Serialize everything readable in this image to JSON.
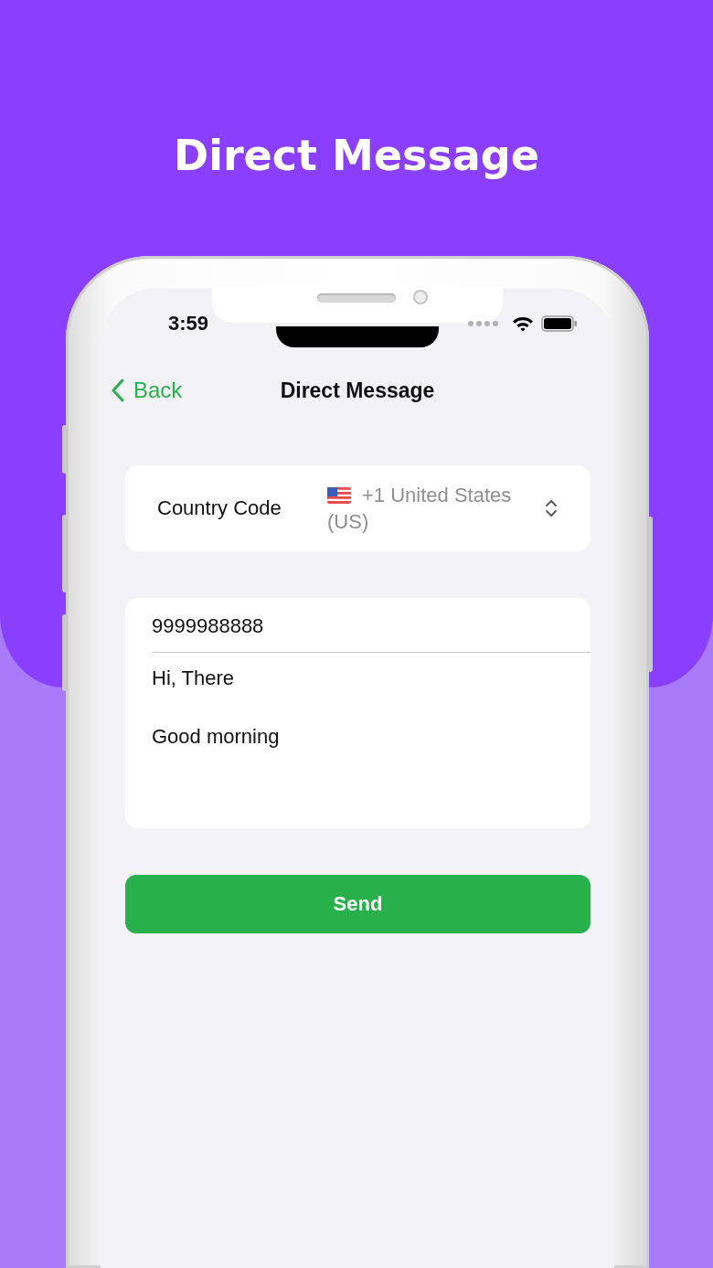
{
  "headline": "Direct Message",
  "status_bar": {
    "time": "3:59"
  },
  "nav": {
    "back": "Back",
    "title": "Direct Message"
  },
  "country": {
    "label": "Country Code",
    "value": "+1 United States (US)"
  },
  "phone_field": {
    "value": "9999988888"
  },
  "message_field": {
    "value": "Hi, There\n\nGood morning"
  },
  "send_button": {
    "label": "Send"
  }
}
